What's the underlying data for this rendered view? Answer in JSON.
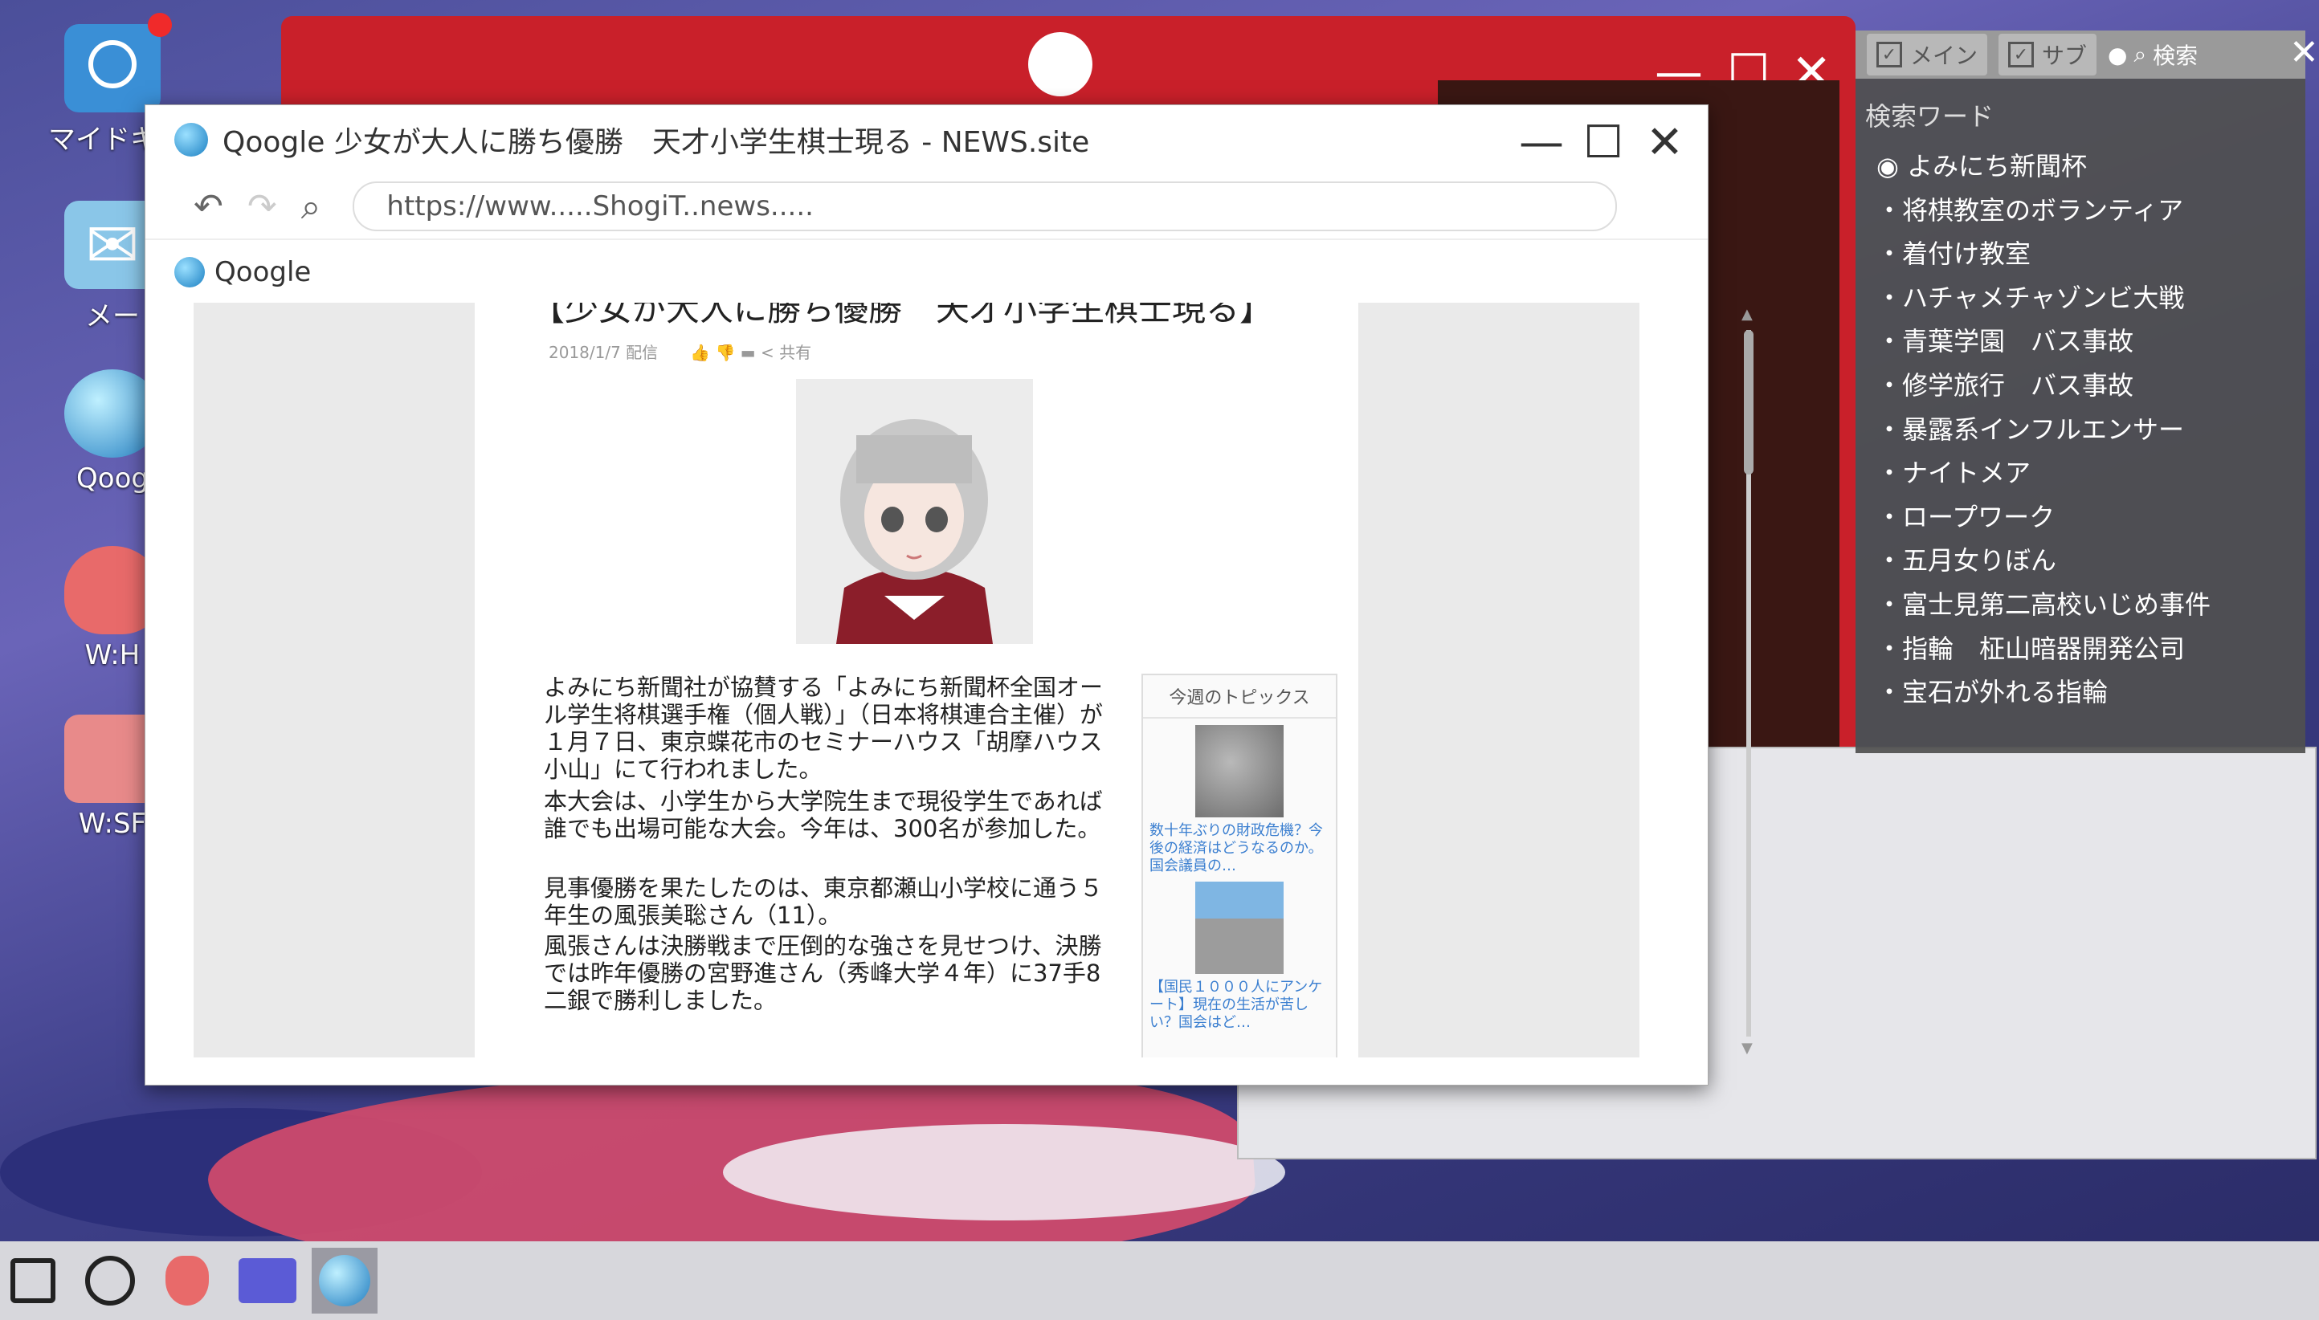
{
  "desktop": {
    "icons": [
      {
        "label": "マイドキュ",
        "name": "mydocs"
      },
      {
        "label": "メー",
        "name": "mail"
      },
      {
        "label": "Qoog",
        "name": "qoogle"
      },
      {
        "label": "W:H",
        "name": "wh"
      },
      {
        "label": "W:SF",
        "name": "wsf"
      }
    ]
  },
  "search_panel": {
    "tab_main": "メイン",
    "tab_sub": "サブ",
    "tab_search": "検索",
    "heading": "検索ワード",
    "items": [
      "よみにち新聞杯",
      "将棋教室のボランティア",
      "着付け教室",
      "ハチャメチャゾンビ大戦",
      "青葉学園　バス事故",
      "修学旅行　バス事故",
      "暴露系インフルエンサー",
      "ナイトメア",
      "ロープワーク",
      "五月女りぼん",
      "富士見第二高校いじめ事件",
      "指輪　柾山暗器開発公司",
      "宝石が外れる指輪"
    ]
  },
  "browser": {
    "title": "Qoogle 少女が大人に勝ち優勝　天才小学生棋士現る - NEWS.site",
    "url": "https://www.....ShogiT..news.....",
    "bookmark": "Qoogle",
    "article": {
      "headline": "【少女が大人に勝ち優勝　天才小学生棋士現る】",
      "date": "2018/1/7 配信",
      "share": "共有",
      "p1": "よみにち新聞社が協賛する「よみにち新聞杯全国オール学生将棋選手権（個人戦）」（日本将棋連合主催）が１月７日、東京蝶花市のセミナーハウス「胡摩ハウス小山」にて行われました。",
      "p2": "本大会は、小学生から大学院生まで現役学生であれば誰でも出場可能な大会。今年は、300名が参加した。",
      "p3": "見事優勝を果たしたのは、東京都瀬山小学校に通う５年生の風張美聡さん（11）。",
      "p4": "風張さんは決勝戦まで圧倒的な強さを見せつけ、決勝では昨年優勝の宮野進さん（秀峰大学４年）に37手8二銀で勝利しました。"
    },
    "topics": {
      "heading": "今週のトピックス",
      "t1": "数十年ぶりの財政危機？今後の経済はどうなるのか。国会議員の…",
      "t2": "【国民１０００人にアンケート】現在の生活が苦しい？国会はど…"
    }
  },
  "colors": {
    "accent_red": "#c9202a",
    "link_blue": "#3b7fd0"
  }
}
